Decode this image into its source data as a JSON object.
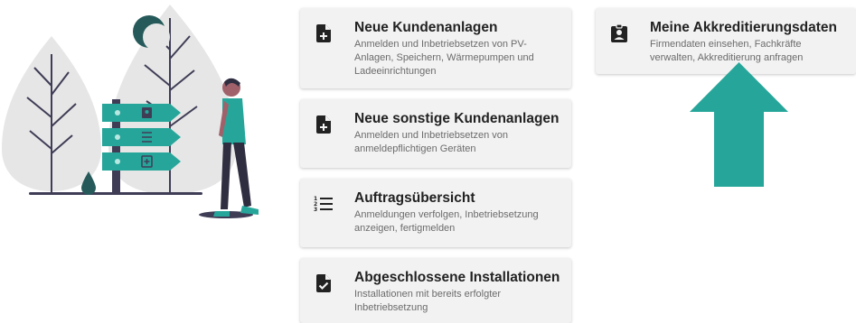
{
  "cards": [
    {
      "title": "Neue Kundenanlagen",
      "description": "Anmelden und Inbetriebsetzen von PV-Anlagen, Speichern, Wärmepumpen und Ladeeinrichtungen",
      "icon": "file-plus-icon"
    },
    {
      "title": "Neue sonstige Kundenanlagen",
      "description": "Anmelden und Inbetriebsetzen von anmeldepflichtigen Geräten",
      "icon": "file-plus-icon"
    },
    {
      "title": "Auftragsübersicht",
      "description": "Anmeldungen verfolgen, Inbetriebsetzung anzeigen, fertigmelden",
      "icon": "numbered-list-icon"
    },
    {
      "title": "Abgeschlossene Installationen",
      "description": "Installationen mit bereits erfolgter Inbetriebsetzung",
      "icon": "file-check-icon"
    },
    {
      "title": "Meine Akkreditierungsdaten",
      "description": "Firmendaten einsehen, Fachkräfte verwalten, Akkreditierung anfragen",
      "icon": "id-badge-icon"
    }
  ],
  "colors": {
    "teal": "#26a69a",
    "teal_light": "#7fcfc8",
    "dark_teal": "#265a5a",
    "title": "#222222",
    "desc": "#6b6b6b",
    "card_bg": "#f2f2f2",
    "tree": "#e6e6e6",
    "pole": "#3f3d56"
  }
}
